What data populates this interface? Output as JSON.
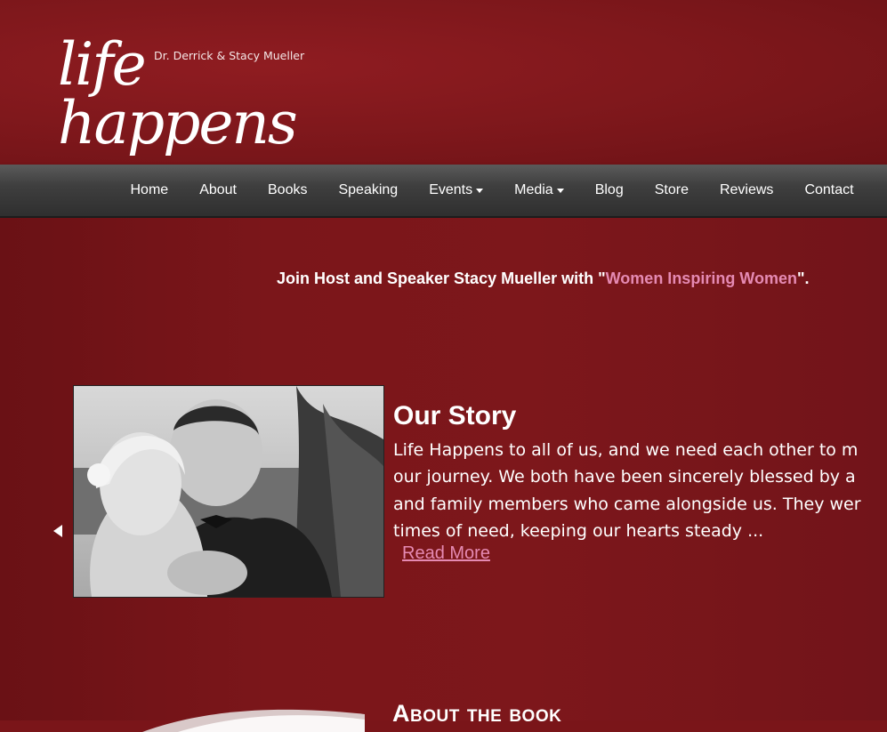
{
  "logo": {
    "script_text": "life happens",
    "byline": "Dr. Derrick & Stacy Mueller"
  },
  "nav": {
    "items": [
      {
        "label": "Home",
        "dropdown": false
      },
      {
        "label": "About",
        "dropdown": false
      },
      {
        "label": "Books",
        "dropdown": false
      },
      {
        "label": "Speaking",
        "dropdown": false
      },
      {
        "label": "Events",
        "dropdown": true
      },
      {
        "label": "Media",
        "dropdown": true
      },
      {
        "label": "Blog",
        "dropdown": false
      },
      {
        "label": "Store",
        "dropdown": false
      },
      {
        "label": "Reviews",
        "dropdown": false
      },
      {
        "label": "Contact",
        "dropdown": false
      }
    ]
  },
  "announcement": {
    "prefix": "Join Host and Speaker Stacy Mueller with \"",
    "link": "Women Inspiring Women",
    "suffix": "\"."
  },
  "story": {
    "title": "Our Story",
    "lines": [
      " Life Happens to all of us, and we need each other to m",
      "our journey. We both have been sincerely blessed by a",
      "and family members who came alongside us. They wer",
      "times of need, keeping our hearts steady ..."
    ],
    "read_more": "Read More"
  },
  "about": {
    "title": "About the book"
  },
  "colors": {
    "background": "#7a1519",
    "accent_pink": "#e58ab3",
    "nav_bar": "#3f3f3f",
    "text": "#ffffff"
  }
}
